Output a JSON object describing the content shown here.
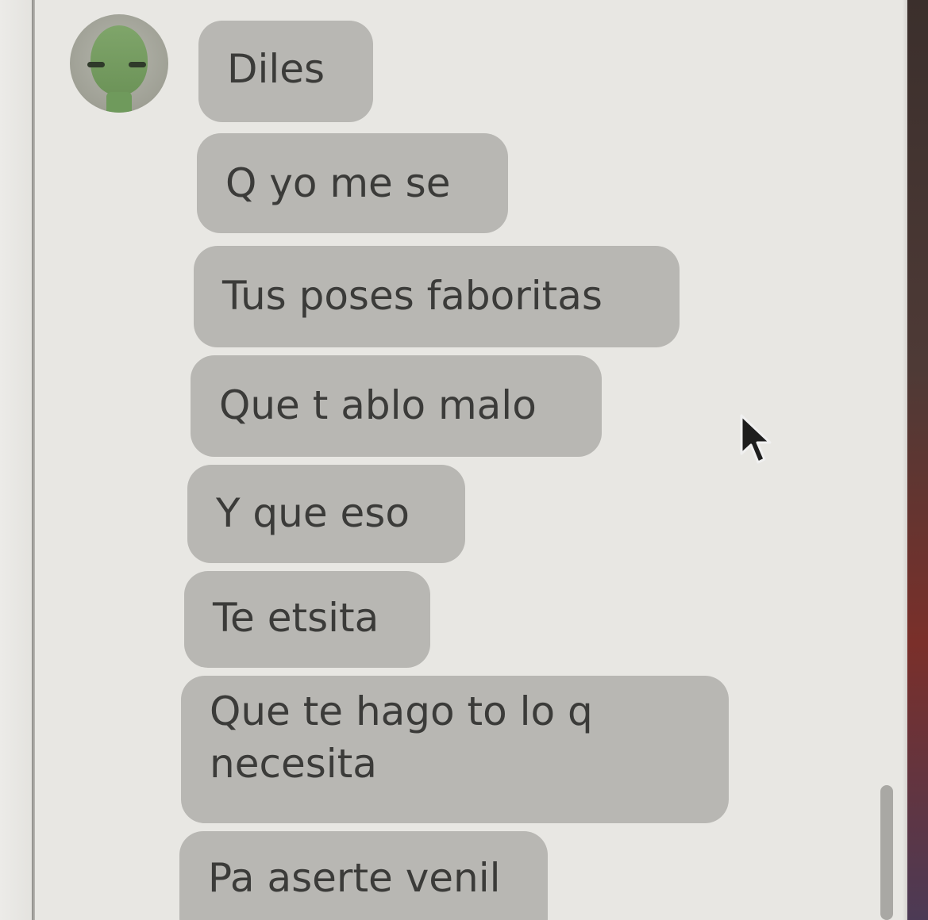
{
  "chat": {
    "messages": [
      {
        "text": "Diles"
      },
      {
        "text": "Q yo me se"
      },
      {
        "text": "Tus poses faboritas"
      },
      {
        "text": "Que t ablo malo"
      },
      {
        "text": "Y que eso"
      },
      {
        "text": "Te etsita"
      },
      {
        "text": "Que te hago to lo q necesita"
      },
      {
        "text": "Pa aserte venil"
      }
    ]
  },
  "colors": {
    "bubble": "#b8b7b3",
    "text": "#3b3b39",
    "background": "#e8e7e3",
    "avatar_face": "#7fa56a"
  },
  "icons": {
    "avatar": "alien-avatar-icon",
    "cursor": "mouse-pointer-icon"
  }
}
